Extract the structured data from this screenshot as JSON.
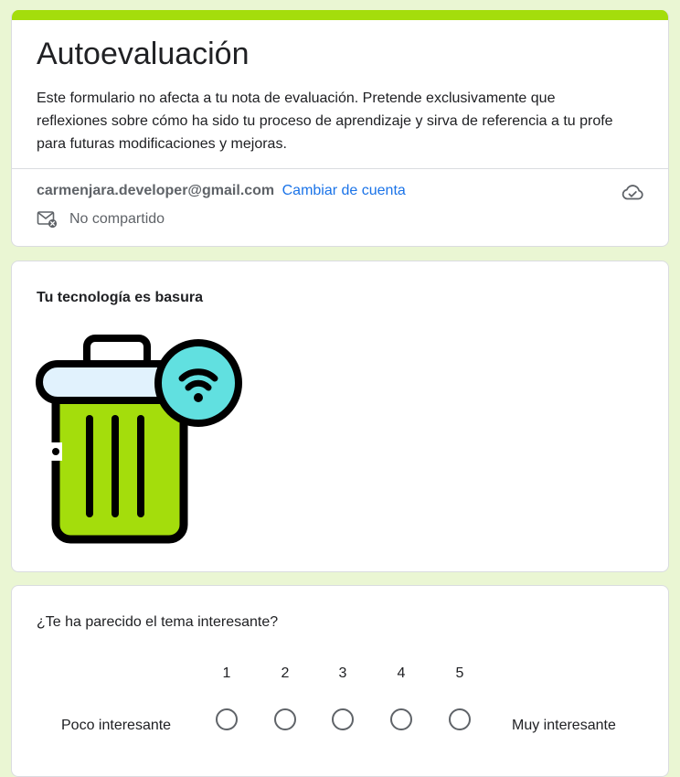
{
  "form": {
    "title": "Autoevaluación",
    "description_lines": [
      "Este formulario no afecta a tu nota de evaluación. Pretende exclusivamente que",
      "reflexiones sobre cómo ha sido tu proceso de aprendizaje y sirva de referencia a tu profe",
      "para futuras modificaciones y mejoras."
    ],
    "accent_color": "#A4DD0C",
    "background_color": "#EAF6D3"
  },
  "account": {
    "email": "carmenjara.developer@gmail.com",
    "switch_label": "Cambiar de cuenta",
    "sharing_status": "No compartido",
    "cloud_icon": "cloud-check-icon",
    "sharing_icon": "mail-off-icon"
  },
  "image_item": {
    "title": "Tu tecnología es basura",
    "image_icon": "wifi-trash-can-icon"
  },
  "question": {
    "text": "¿Te ha parecido el tema interesante?",
    "scale": [
      "1",
      "2",
      "3",
      "4",
      "5"
    ],
    "low_label": "Poco interesante",
    "high_label": "Muy interesante"
  }
}
